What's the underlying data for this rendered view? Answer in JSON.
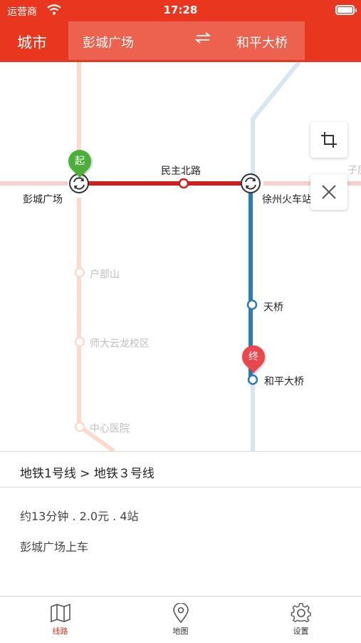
{
  "status_bar": {
    "carrier": "运营商",
    "time": "17:28"
  },
  "nav": {
    "city_label": "城市",
    "from_station": "彭城广场",
    "swap_icon": "swap-arrows-icon",
    "to_station": "和平大桥"
  },
  "map": {
    "stations": {
      "pengcheng": "彭城广场",
      "minzhubeilu": "民主北路",
      "xuzhou_station": "徐州火车站",
      "tianqiao": "天桥",
      "heping": "和平大桥",
      "hubushan": "户部山",
      "shida": "师大云龙校区",
      "zhongxin": "中心医院",
      "edge_label": "子房"
    },
    "start_pin": "起",
    "end_pin": "终",
    "colors": {
      "line1": "#cc1f1f",
      "line3": "#2f7bb7",
      "accent": "#e8371e"
    },
    "buttons": {
      "crop": "crop-icon",
      "close": "close-icon"
    }
  },
  "route": {
    "lines": "地铁1号线 > 地铁３号线",
    "summary": "约13分钟 . 2.0元 . 4站",
    "boarding": "彭城广场上车"
  },
  "tabs": [
    {
      "label": "线路",
      "icon": "map-icon",
      "active": true
    },
    {
      "label": "地图",
      "icon": "location-pin-icon",
      "active": false
    },
    {
      "label": "设置",
      "icon": "gear-icon",
      "active": false
    }
  ]
}
